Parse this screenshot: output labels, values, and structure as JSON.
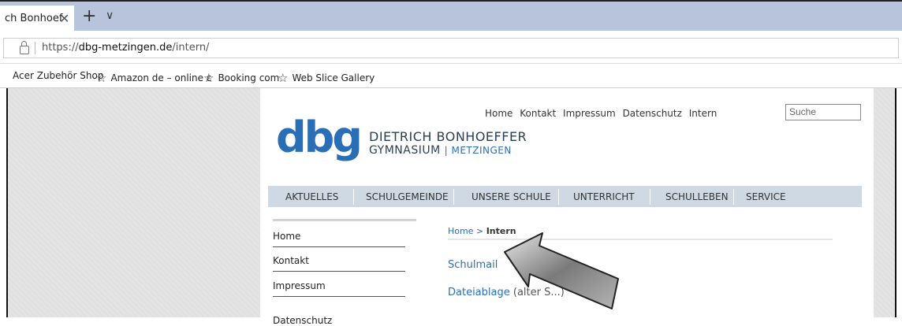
{
  "browser": {
    "tab_title": "ch Bonhoef",
    "tab_close": "✕",
    "new_tab": "+",
    "tab_menu": "∨",
    "url_prefix": "https://",
    "url_domain": "dbg-metzingen.de",
    "url_path": "/intern/",
    "favorites": [
      {
        "label": "Acer Zubehör Shop",
        "star": false
      },
      {
        "label": "Amazon de – online ε",
        "star": true
      },
      {
        "label": "Booking com",
        "star": true
      },
      {
        "label": "Web Slice Gallery",
        "star": true
      }
    ]
  },
  "site": {
    "topnav": [
      "Home",
      "Kontakt",
      "Impressum",
      "Datenschutz",
      "Intern"
    ],
    "search_placeholder": "Suche",
    "logo": {
      "mark": "dbg",
      "line1": "DIETRICH BONHOEFFER",
      "line2a": "GYMNASIUM",
      "line2b": "| METZINGEN"
    },
    "mainnav": [
      "AKTUELLES",
      "SCHULGEMEINDE",
      "UNSERE SCHULE",
      "UNTERRICHT",
      "SCHULLEBEN",
      "SERVICE"
    ],
    "sidebar": [
      "Home",
      "Kontakt",
      "Impressum",
      "Datenschutz"
    ],
    "breadcrumb": {
      "home": "Home",
      "sep": " > ",
      "current": "Intern"
    },
    "links": [
      {
        "label": "Schulmail",
        "suffix": ""
      },
      {
        "label": "Dateiablage",
        "suffix": " (alter S...)"
      }
    ]
  },
  "colors": {
    "accent": "#2a6fb5",
    "nav_bg": "#cfd9e4",
    "tabbar": "#b8c4dc"
  }
}
